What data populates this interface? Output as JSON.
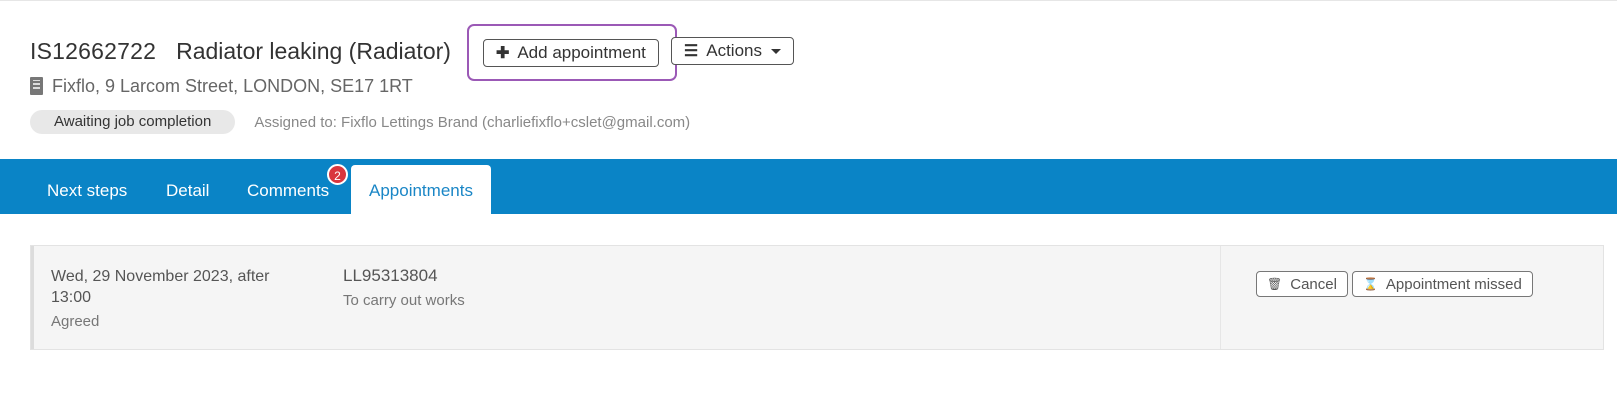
{
  "header": {
    "job_ref": "IS12662722",
    "job_title": "Radiator leaking (Radiator)",
    "add_appointment_label": "Add appointment",
    "actions_label": "Actions",
    "address": "Fixflo, 9 Larcom Street, LONDON, SE17 1RT",
    "status": "Awaiting job completion",
    "assigned": "Assigned to: Fixflo Lettings Brand (charliefixflo+cslet@gmail.com)"
  },
  "tabs": [
    {
      "label": "Next steps"
    },
    {
      "label": "Detail"
    },
    {
      "label": "Comments",
      "badge": "2"
    },
    {
      "label": "Appointments",
      "active": true
    }
  ],
  "appointment": {
    "date": "Wed, 29 November 2023, after 13:00",
    "status": "Agreed",
    "ref": "LL95313804",
    "purpose": "To carry out works",
    "cancel_label": "Cancel",
    "missed_label": "Appointment missed"
  },
  "colors": {
    "tab_bar": "#0a84c6",
    "highlight": "#9b59b6",
    "badge": "#d9363e"
  },
  "icons": {
    "add": "plus-icon",
    "actions": "list-icon",
    "address": "building-icon",
    "cancel": "trash-icon",
    "missed": "hourglass-icon"
  }
}
